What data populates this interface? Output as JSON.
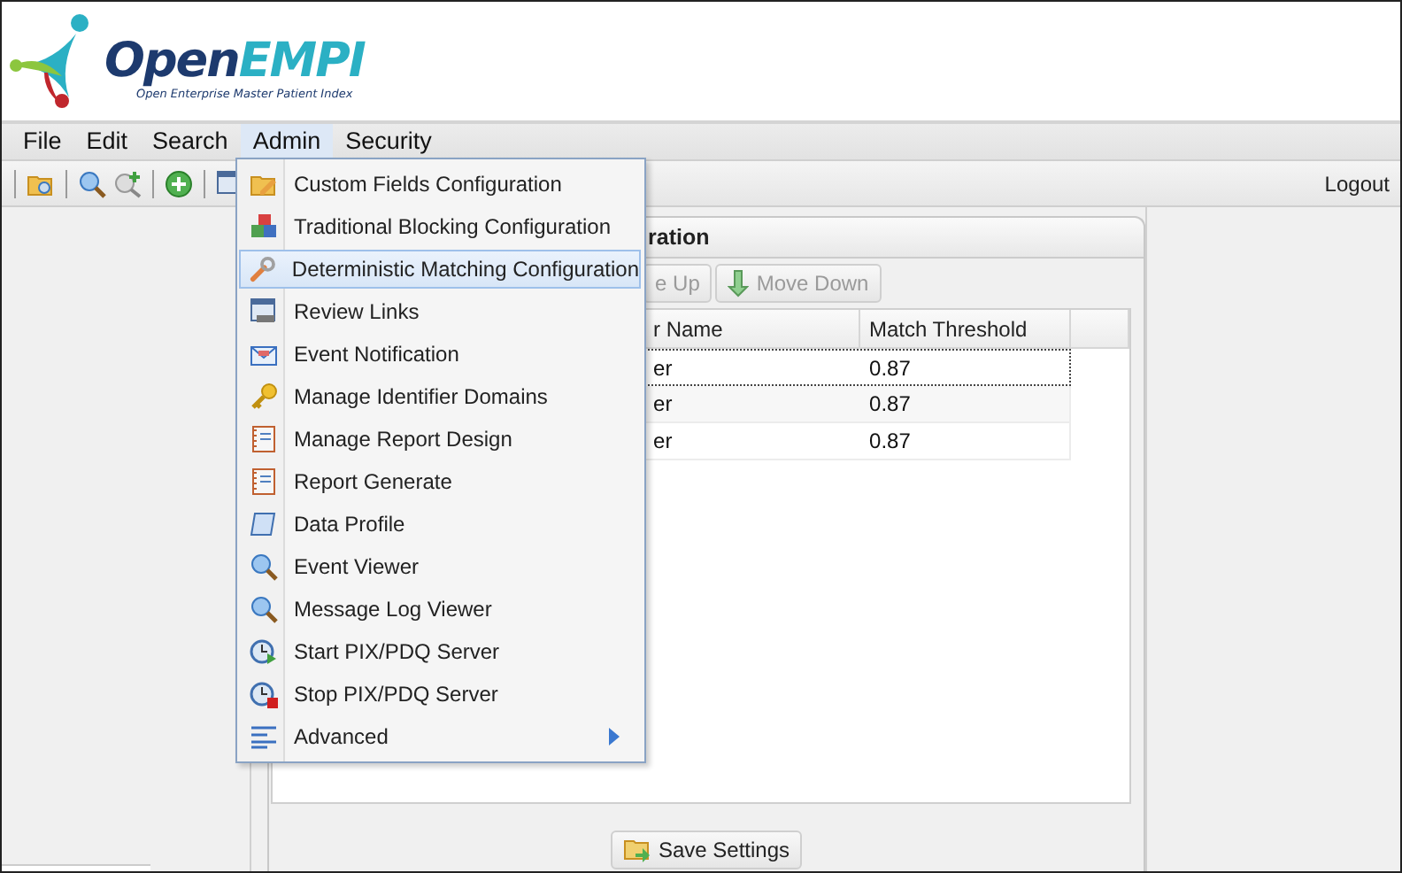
{
  "header": {
    "logo": {
      "first": "Open",
      "second": "EMPI",
      "tagline": "Open Enterprise Master Patient Index"
    }
  },
  "menu_bar": [
    {
      "label": "File",
      "selected": false
    },
    {
      "label": "Edit",
      "selected": false
    },
    {
      "label": "Search",
      "selected": false
    },
    {
      "label": "Admin",
      "selected": true
    },
    {
      "label": "Security",
      "selected": false
    }
  ],
  "toolbar": {
    "logout": "Logout"
  },
  "admin_menu": [
    {
      "label": "Custom Fields Configuration",
      "kind": "item",
      "selected": false
    },
    {
      "label": "Traditional Blocking Configuration",
      "kind": "item",
      "selected": false
    },
    {
      "label": "Deterministic Matching Configuration",
      "kind": "item",
      "selected": true
    },
    {
      "label": "Review Links",
      "kind": "item",
      "selected": false
    },
    {
      "label": "Event Notification",
      "kind": "item",
      "selected": false
    },
    {
      "label": "Manage Identifier Domains",
      "kind": "item",
      "selected": false
    },
    {
      "label": "Manage Report Design",
      "kind": "item",
      "selected": false
    },
    {
      "label": "Report Generate",
      "kind": "item",
      "selected": false
    },
    {
      "label": "Data Profile",
      "kind": "item",
      "selected": false
    },
    {
      "label": "Event Viewer",
      "kind": "item",
      "selected": false
    },
    {
      "label": "Message Log Viewer",
      "kind": "item",
      "selected": false
    },
    {
      "label": "Start PIX/PDQ Server",
      "kind": "item",
      "selected": false
    },
    {
      "label": "Stop PIX/PDQ Server",
      "kind": "item",
      "selected": false
    },
    {
      "label": "Advanced",
      "kind": "submenu",
      "selected": false
    }
  ],
  "panel": {
    "title": "ration",
    "buttons": [
      {
        "label": "e Up",
        "disabled": true
      },
      {
        "label": "Move Down",
        "disabled": true
      }
    ],
    "table": {
      "columns": [
        "r Name",
        "Match Threshold"
      ],
      "rows": [
        {
          "cells": [
            "er",
            "0.87"
          ],
          "selected": true
        },
        {
          "cells": [
            "er",
            "0.87"
          ],
          "selected": false
        },
        {
          "cells": [
            "er",
            "0.87"
          ],
          "selected": false
        }
      ]
    },
    "save_button": "Save Settings"
  }
}
